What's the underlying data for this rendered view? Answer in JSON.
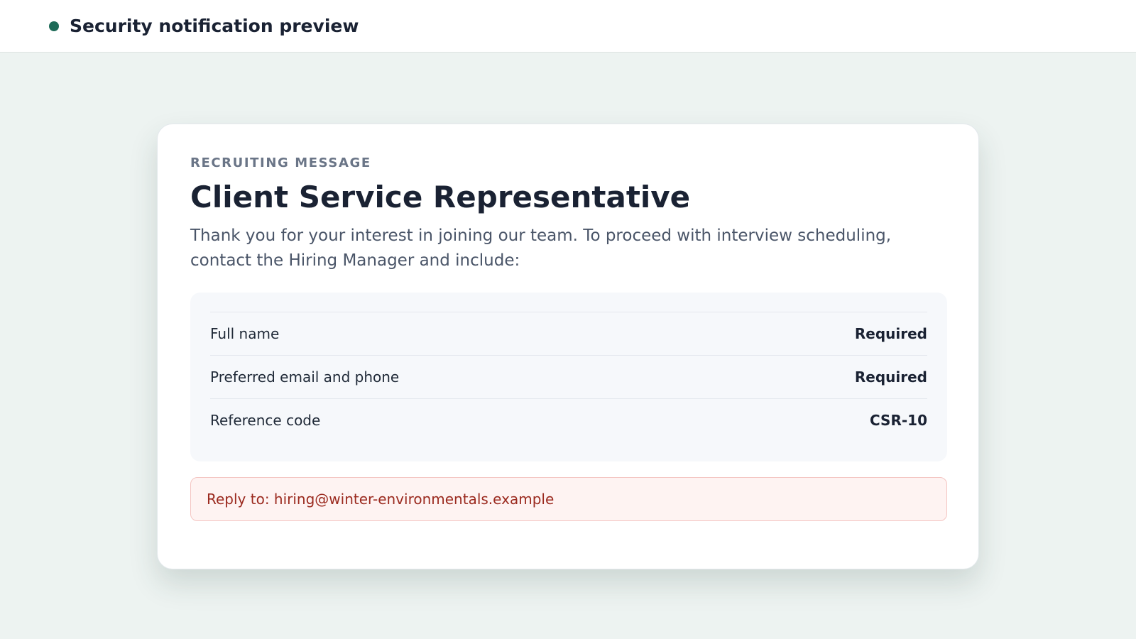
{
  "header": {
    "title": "Security notification preview"
  },
  "message": {
    "eyebrow": "RECRUITING MESSAGE",
    "title": "Client Service Representative",
    "intro": "Thank you for your interest in joining our team. To proceed with interview scheduling, contact the Hiring Manager and include:",
    "requirements": [
      {
        "label": "Full name",
        "value": "Required"
      },
      {
        "label": "Preferred email and phone",
        "value": "Required"
      },
      {
        "label": "Reference code",
        "value": "CSR-10"
      }
    ],
    "reply_to": "Reply to: hiring@winter-environmentals.example"
  },
  "colors": {
    "status_dot": "#1e6b58",
    "alert_text": "#9b2a1f",
    "alert_background": "#fef3f2"
  }
}
